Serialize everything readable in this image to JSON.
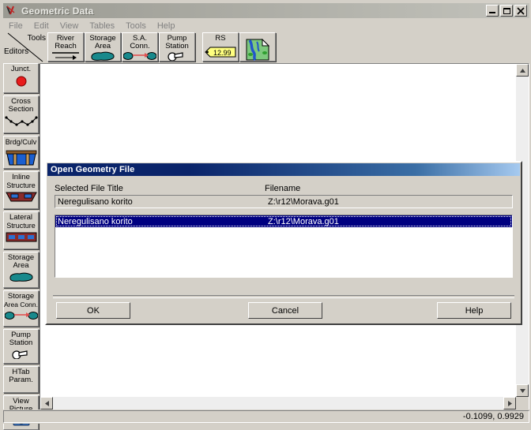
{
  "window": {
    "title": "Geometric Data",
    "icon": "hecras-logo-icon",
    "controls": {
      "minimize": "Minimize",
      "maximize": "Maximize",
      "close": "Close"
    }
  },
  "menubar": {
    "items": [
      {
        "label": "File"
      },
      {
        "label": "Edit"
      },
      {
        "label": "View"
      },
      {
        "label": "Tables"
      },
      {
        "label": "Tools"
      },
      {
        "label": "Help"
      }
    ]
  },
  "toolbar": {
    "corner_label_top": "Tools",
    "corner_label_bottom": "Editors",
    "buttons": [
      {
        "label1": "River",
        "label2": "Reach",
        "icon": "river-reach-icon"
      },
      {
        "label1": "Storage",
        "label2": "Area",
        "icon": "storage-area-icon"
      },
      {
        "label1": "S.A.",
        "label2": "Conn.",
        "icon": "sa-connection-icon"
      },
      {
        "label1": "Pump",
        "label2": "Station",
        "icon": "pump-station-icon"
      }
    ],
    "buttons2": [
      {
        "label1": "RS",
        "label2": "",
        "icon": "river-station-tag-icon",
        "tag_value": "12.99"
      },
      {
        "label1": "",
        "label2": "",
        "icon": "background-picture-icon"
      }
    ]
  },
  "sidebar": {
    "items": [
      {
        "label1": "Junct.",
        "label2": "",
        "icon": "junction-icon"
      },
      {
        "label1": "Cross",
        "label2": "Section",
        "icon": "cross-section-icon"
      },
      {
        "label1": "Brdg/Culv",
        "label2": "",
        "icon": "bridge-culvert-icon"
      },
      {
        "label1": "Inline",
        "label2": "Structure",
        "icon": "inline-structure-icon"
      },
      {
        "label1": "Lateral",
        "label2": "Structure",
        "icon": "lateral-structure-icon"
      },
      {
        "label1": "Storage",
        "label2": "Area",
        "icon": "storage-area-icon"
      },
      {
        "label1": "Storage",
        "label2": "Area Conn.",
        "icon": "storage-area-conn-icon"
      },
      {
        "label1": "Pump",
        "label2": "Station",
        "icon": "pump-station-icon"
      },
      {
        "label1": "HTab",
        "label2": "Param.",
        "icon": "htab-param-icon"
      },
      {
        "label1": "View",
        "label2": "Picture",
        "icon": "view-picture-camera-icon"
      }
    ]
  },
  "dialog": {
    "title": "Open Geometry File",
    "columns": {
      "title": "Selected File Title",
      "filename": "Filename"
    },
    "selected": {
      "title": "Neregulisano korito",
      "filename": "Z:\\r12\\Morava.g01"
    },
    "rows": [
      {
        "title": "Neregulisano korito",
        "filename": "Z:\\r12\\Morava.g01",
        "selected": true
      }
    ],
    "buttons": {
      "ok": "OK",
      "cancel": "Cancel",
      "help": "Help"
    }
  },
  "statusbar": {
    "coordinates": "-0.1099, 0.9929"
  },
  "colors": {
    "face": "#d4d0c8",
    "dialog_title_start": "#0a246a",
    "dialog_title_end": "#a6caf0",
    "selection": "#000080",
    "junction_red": "#e81c1c",
    "storage_teal": "#1c8c8c",
    "tag_yellow": "#ffff80"
  }
}
